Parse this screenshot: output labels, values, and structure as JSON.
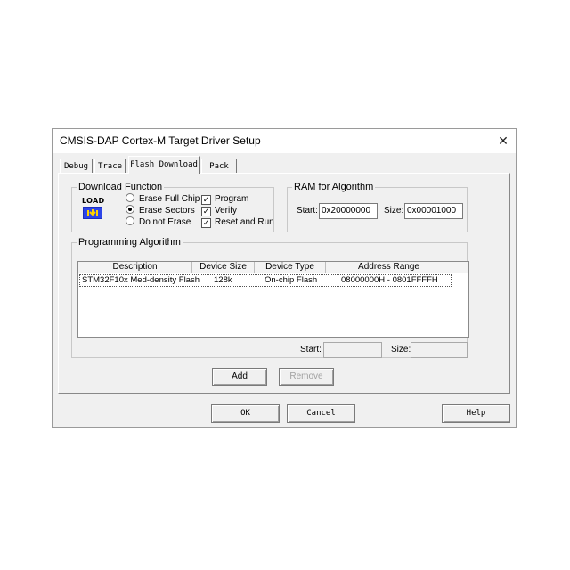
{
  "window": {
    "title": "CMSIS-DAP Cortex-M Target Driver Setup",
    "close_glyph": "✕"
  },
  "tabs": [
    {
      "label": "Debug",
      "active": false
    },
    {
      "label": "Trace",
      "active": false
    },
    {
      "label": "Flash Download",
      "active": true
    },
    {
      "label": "Pack",
      "active": false
    }
  ],
  "download_function": {
    "legend": "Download Function",
    "icon": "load-icon",
    "icon_text": "LOAD",
    "radios": [
      {
        "label": "Erase Full Chip",
        "checked": false
      },
      {
        "label": "Erase Sectors",
        "checked": true
      },
      {
        "label": "Do not Erase",
        "checked": false
      }
    ],
    "checks": [
      {
        "label": "Program",
        "checked": true
      },
      {
        "label": "Verify",
        "checked": true
      },
      {
        "label": "Reset and Run",
        "checked": true
      }
    ]
  },
  "ram": {
    "legend": "RAM for Algorithm",
    "start_label": "Start:",
    "start_value": "0x20000000",
    "size_label": "Size:",
    "size_value": "0x00001000"
  },
  "algorithm": {
    "legend": "Programming Algorithm",
    "columns": [
      "Description",
      "Device Size",
      "Device Type",
      "Address Range"
    ],
    "rows": [
      {
        "description": "STM32F10x Med-density Flash",
        "size": "128k",
        "type": "On-chip Flash",
        "range": "08000000H - 0801FFFFH"
      }
    ],
    "start_label": "Start:",
    "start_value": "",
    "size_label": "Size:",
    "size_value": ""
  },
  "buttons": {
    "add": "Add",
    "remove": "Remove",
    "ok": "OK",
    "cancel": "Cancel",
    "help": "Help"
  }
}
